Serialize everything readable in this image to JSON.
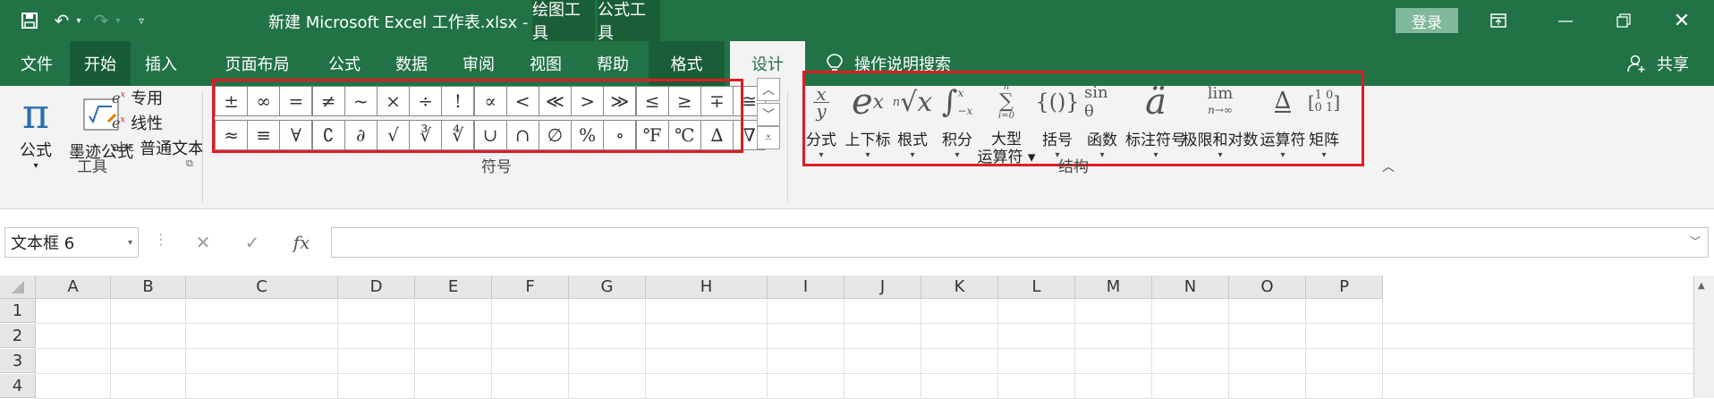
{
  "titlebar": {
    "filename": "新建 Microsoft Excel 工作表.xlsx  -  Excel",
    "ctx_drawing": "绘图工具",
    "ctx_formula": "公式工具",
    "login": "登录"
  },
  "tabs": {
    "file": "文件",
    "home": "开始",
    "insert": "插入",
    "layout": "页面布局",
    "formulas": "公式",
    "data": "数据",
    "review": "审阅",
    "view": "视图",
    "help": "帮助",
    "format": "格式",
    "design": "设计",
    "search": "操作说明搜索",
    "share": "共享"
  },
  "tools": {
    "equation": "公式",
    "ink": "墨迹公式",
    "professional": "专用",
    "linear": "线性",
    "normal_text": "普通文本",
    "abc": "abc",
    "group_label": "工具"
  },
  "symbols": {
    "row1": [
      "±",
      "∞",
      "=",
      "≠",
      "~",
      "×",
      "÷",
      "!",
      "∝",
      "<",
      "≪",
      ">",
      "≫",
      "≤",
      "≥",
      "∓",
      "≅"
    ],
    "row2": [
      "≈",
      "≡",
      "∀",
      "∁",
      "∂",
      "√",
      "∛",
      "∜",
      "∪",
      "∩",
      "∅",
      "%",
      "∘",
      "℉",
      "℃",
      "∆",
      "∇"
    ],
    "group_label": "符号"
  },
  "structures": {
    "items": [
      {
        "label": "分式"
      },
      {
        "label": "上下标"
      },
      {
        "label": "根式"
      },
      {
        "label": "积分"
      },
      {
        "label": "大型\n运算符"
      },
      {
        "label": "括号"
      },
      {
        "label": "函数"
      },
      {
        "label": "标注符号"
      },
      {
        "label": "极限和对数"
      },
      {
        "label": "运算符"
      },
      {
        "label": "矩阵"
      }
    ],
    "group_label": "结构"
  },
  "formula_bar": {
    "name_box": "文本框 6",
    "fx": "fx",
    "value": ""
  },
  "grid": {
    "columns": [
      "A",
      "B",
      "C",
      "D",
      "E",
      "F",
      "G",
      "H",
      "I",
      "J",
      "K",
      "L",
      "M",
      "N",
      "O",
      "P"
    ],
    "rows": [
      "1",
      "2",
      "3",
      "4"
    ]
  },
  "colors": {
    "excel_green": "#217346",
    "highlight_red": "#e01b24"
  }
}
